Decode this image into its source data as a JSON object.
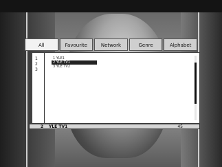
{
  "tabs": [
    {
      "label": "All",
      "active": true
    },
    {
      "label": "Favourite",
      "active": false
    },
    {
      "label": "Network",
      "active": false
    },
    {
      "label": "Genre",
      "active": false
    },
    {
      "label": "Alphabet",
      "active": false
    }
  ],
  "list": {
    "numbers": [
      "1",
      "2",
      "3"
    ],
    "channels": [
      {
        "label": "1 YLE1",
        "selected": false
      },
      {
        "label": "2 YLE TV1",
        "selected": true
      },
      {
        "label": "3 YLE TV2",
        "selected": false
      }
    ]
  },
  "status": {
    "number": "2",
    "channel": "YLE TV1",
    "value": "45"
  },
  "colors": {
    "selection": "#222222",
    "panel": "#ffffff",
    "tab": "#cfcfcf"
  }
}
